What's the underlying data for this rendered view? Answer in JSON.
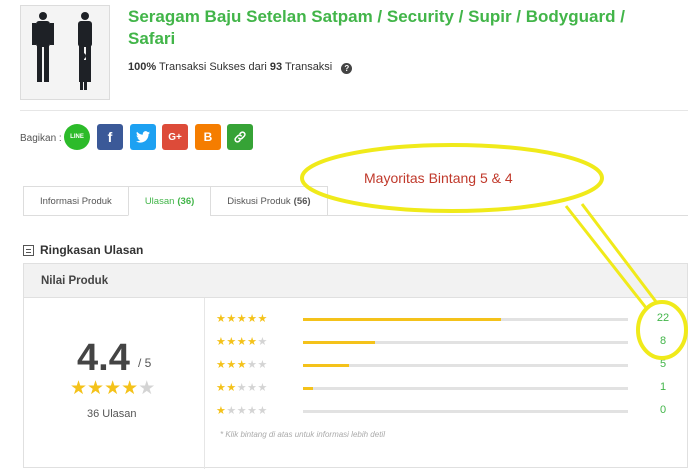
{
  "product": {
    "title": "Seragam Baju Setelan Satpam / Security / Supir / Bodyguard / Safari",
    "success_pct": "100%",
    "success_text": "Transaksi Sukses dari",
    "tx_count": "93",
    "tx_word": "Transaksi",
    "help_icon": "question-circle-icon"
  },
  "share": {
    "label": "Bagikan :",
    "buttons": [
      {
        "name": "line",
        "glyph": "LINE",
        "color": "#2cbb2a"
      },
      {
        "name": "facebook",
        "glyph": "f",
        "color": "#3b5998"
      },
      {
        "name": "twitter",
        "glyph": "🐦",
        "color": "#1da1f2"
      },
      {
        "name": "google-plus",
        "glyph": "G+",
        "color": "#dd4b39"
      },
      {
        "name": "blogger",
        "glyph": "B",
        "color": "#f57d00"
      },
      {
        "name": "copy-link",
        "glyph": "🔗",
        "color": "#36a336"
      }
    ]
  },
  "tabs": [
    {
      "label": "Informasi Produk",
      "count": ""
    },
    {
      "label": "Ulasan",
      "count": "(36)"
    },
    {
      "label": "Diskusi Produk",
      "count": "(56)"
    }
  ],
  "summary": {
    "heading": "Ringkasan Ulasan",
    "panel_title": "Nilai Produk",
    "score": "4.4",
    "score_of": "/ 5",
    "avg_stars": 4,
    "reviews_label": "36 Ulasan",
    "note": "* Klik bintang di atas untuk informasi lebih detil",
    "breakdown": [
      {
        "stars": 5,
        "count": 22,
        "fraction": 0.61
      },
      {
        "stars": 4,
        "count": 8,
        "fraction": 0.22
      },
      {
        "stars": 3,
        "count": 5,
        "fraction": 0.14
      },
      {
        "stars": 2,
        "count": 1,
        "fraction": 0.03
      },
      {
        "stars": 1,
        "count": 0,
        "fraction": 0
      }
    ]
  },
  "annotation": {
    "text": "Mayoritas Bintang 5 & 4",
    "color": "#f0ea1a",
    "text_color": "#c0392b"
  },
  "colors": {
    "accent": "#42b549",
    "star": "#f4c21a"
  }
}
